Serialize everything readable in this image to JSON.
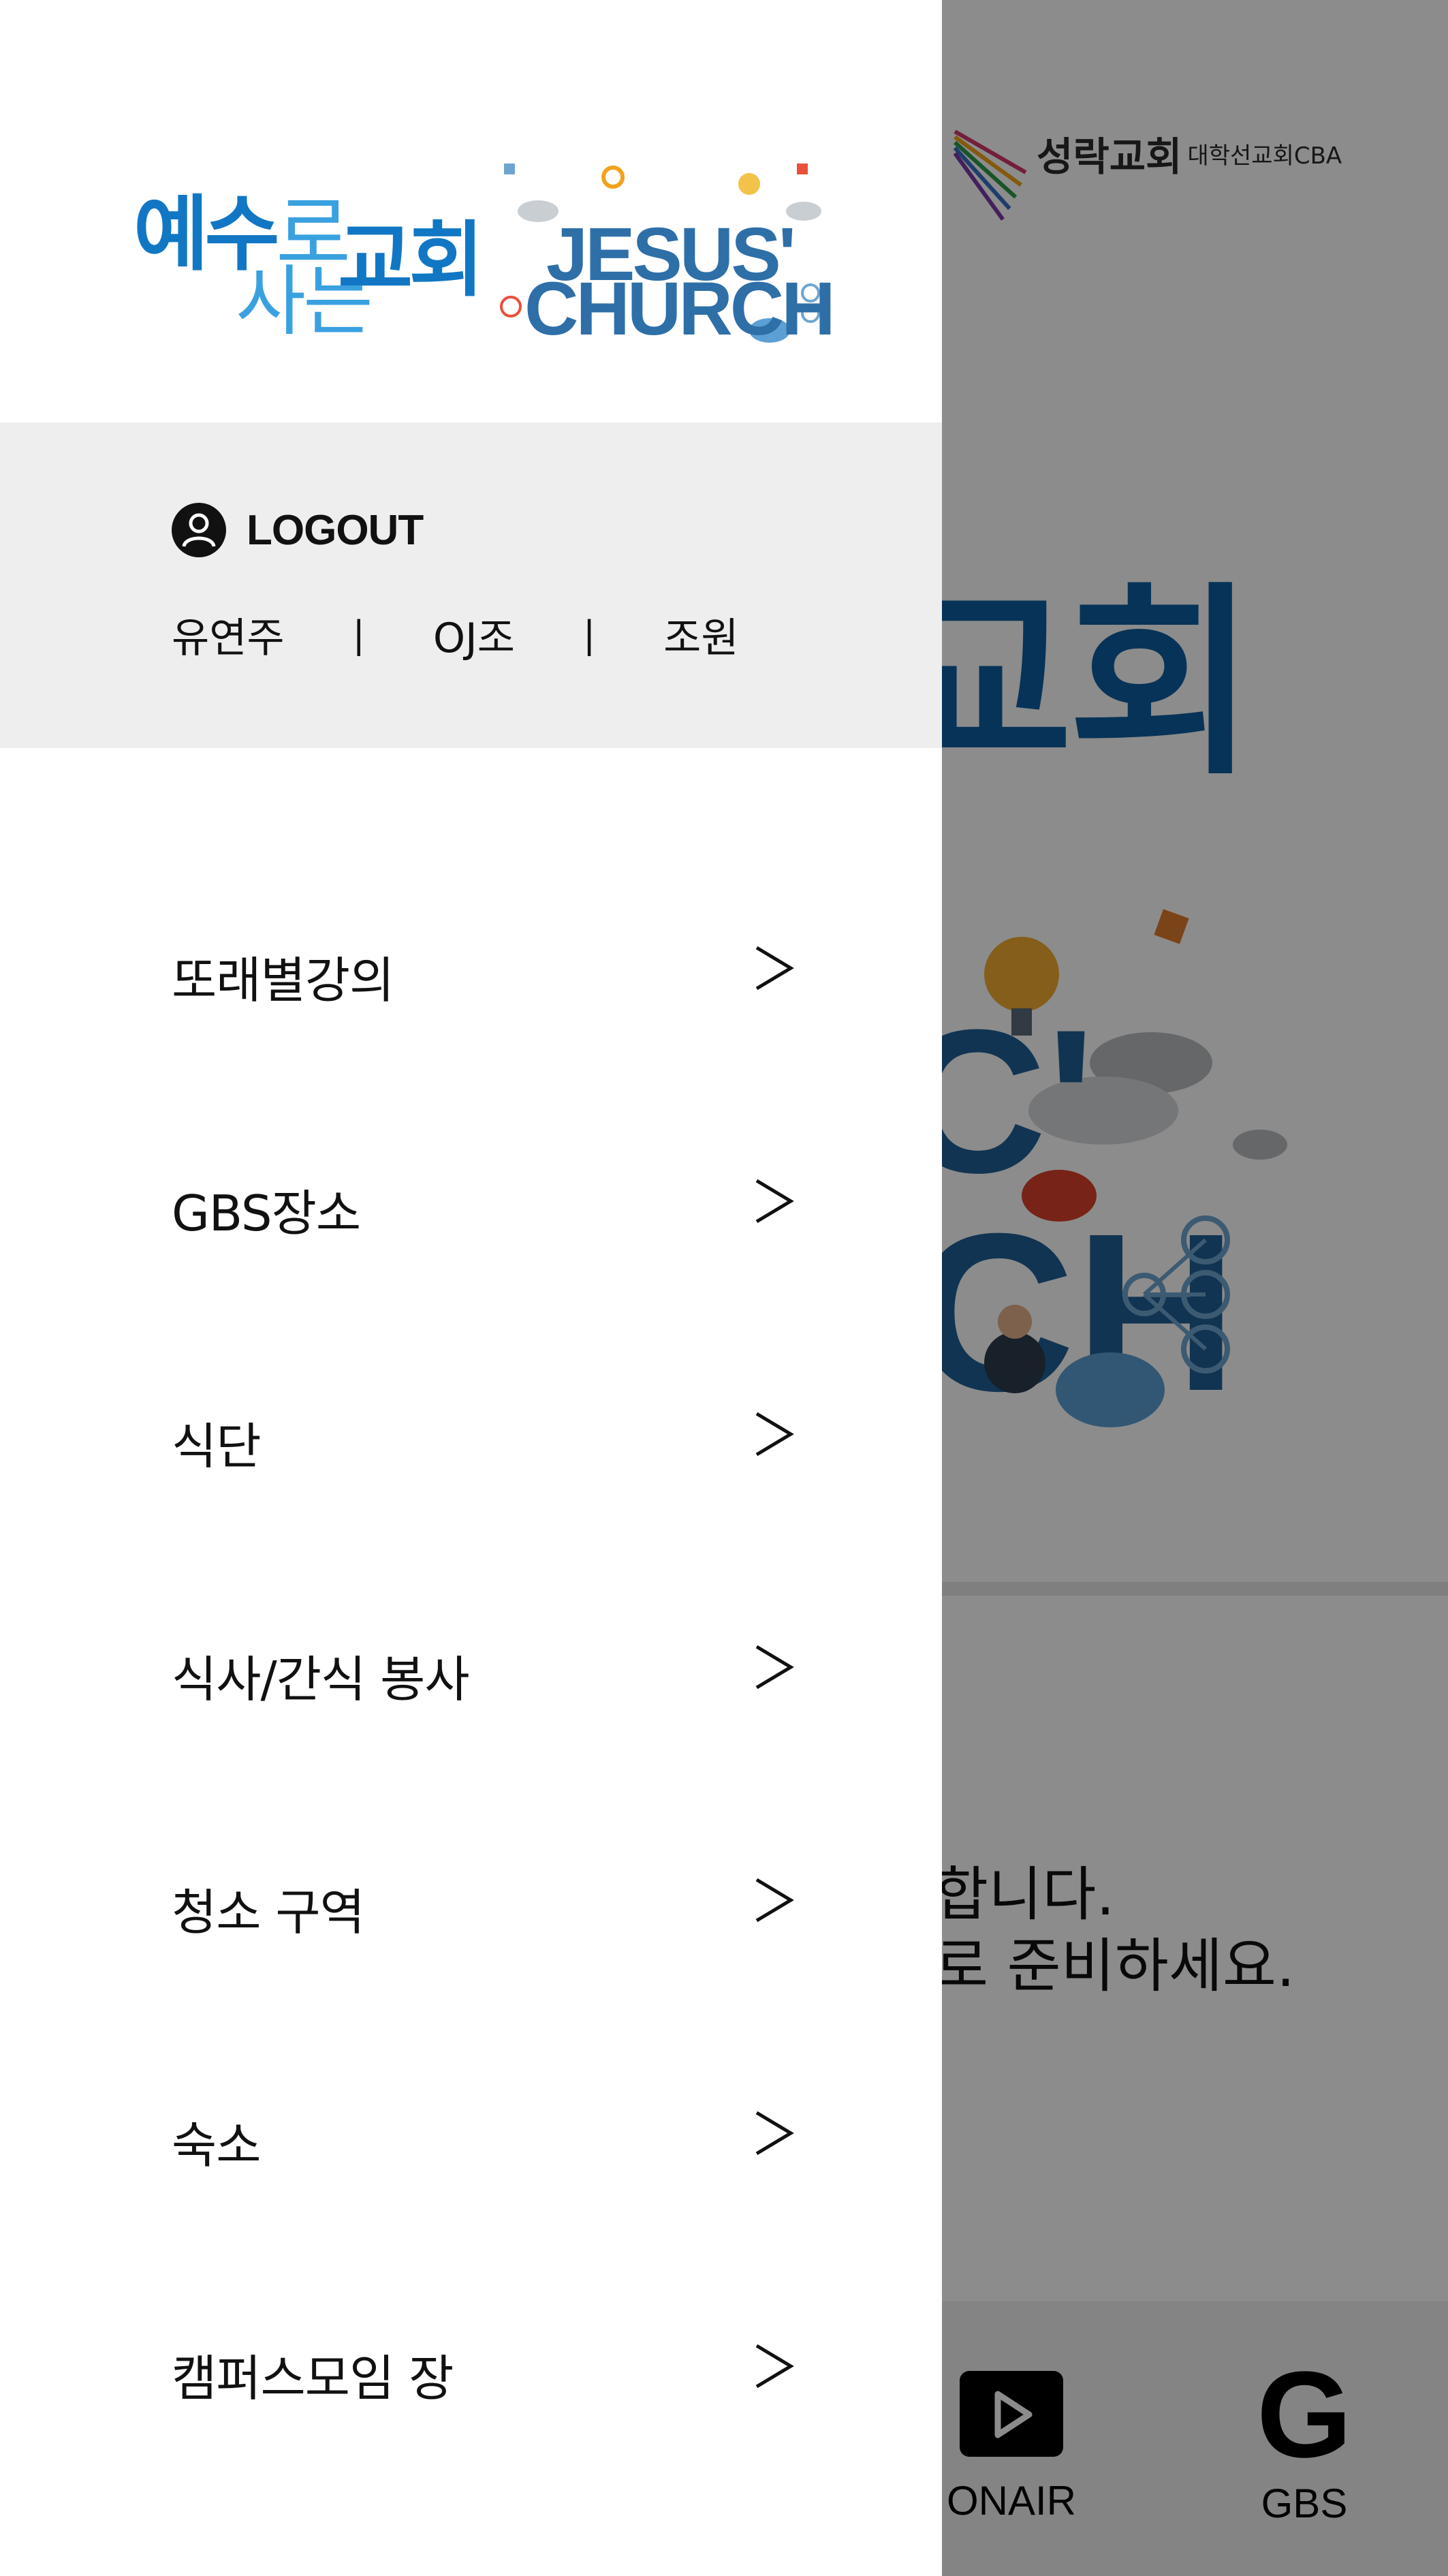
{
  "background": {
    "logo": {
      "church": "성락교회",
      "subtitle": "대학선교회CBA"
    },
    "hero_partial_title": "교회",
    "notice_lines": [
      "합니다.",
      "로 준비하세요."
    ],
    "bottom_nav": [
      {
        "label": "ONAIR",
        "icon": "play-icon"
      },
      {
        "label": "GBS",
        "icon": "g-letter-icon"
      }
    ]
  },
  "drawer": {
    "logo": {
      "kr_line1": "예수로",
      "kr_line1_bold": "예수",
      "kr_line1_thin": "로",
      "kr_church": "교회",
      "kr_line2": "사는",
      "en_line1": "JESUS'",
      "en_line2": "CHURCH"
    },
    "user": {
      "logout_label": "LOGOUT",
      "name": "유연주",
      "group": "OJ조",
      "role": "조원",
      "separator": "|"
    },
    "menu": [
      {
        "label": "또래별강의"
      },
      {
        "label": "GBS장소"
      },
      {
        "label": "식단"
      },
      {
        "label": "식사/간식 봉사"
      },
      {
        "label": "청소 구역"
      },
      {
        "label": "숙소"
      },
      {
        "label": "캠퍼스모임 장"
      }
    ],
    "chevron_glyph": ">"
  },
  "colors": {
    "brand_blue": "#1177c4",
    "light_blue": "#3aa1e0",
    "user_box_bg": "#eeeeee",
    "overlay": "rgba(0,0,0,0.45)"
  }
}
